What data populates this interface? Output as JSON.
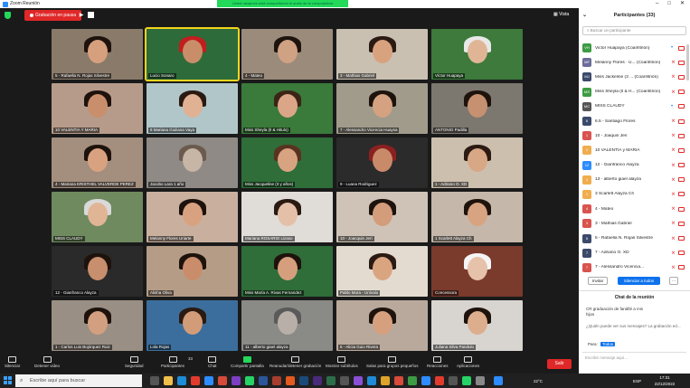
{
  "window": {
    "title": "Zoom Reunión",
    "controls": [
      "–",
      "□",
      "✕"
    ]
  },
  "top_bar": {
    "recording_label": "Grabación en pausa",
    "notice": "Usted rasapnes está compartiendo el audio de la computadora",
    "view_label": "Vista"
  },
  "tiles": [
    {
      "name": "5 - Rafaella N. Rojas Silvestre",
      "bg": "#8a7a6a",
      "skin": "#d6a07e",
      "hair": "#1e120c"
    },
    {
      "name": "Lucio Sonaro",
      "bg": "#2d6b3a",
      "skin": "#c98d6a",
      "hair": "#c21e1e",
      "active": true
    },
    {
      "name": "4 - Mateo",
      "bg": "#9b8b7b",
      "skin": "#cfa283",
      "hair": "#1e140e"
    },
    {
      "name": "3 - Mathias Gabriel",
      "bg": "#c9c0b2",
      "skin": "#d9a27e",
      "hair": "#2a1a12"
    },
    {
      "name": "Víctor Huapaya",
      "bg": "#3d7a3c",
      "skin": "#e0b596",
      "hair": "#e8e8e8"
    },
    {
      "name": "10 VALENTIA Y MARIA",
      "bg": "#b79b8a",
      "skin": "#c98e6b",
      "hair": "#1e120c"
    },
    {
      "name": "8 Mariana Giuliana Vaya",
      "bg": "#b1c6c9",
      "skin": "#e1b193",
      "hair": "#2a1a12"
    },
    {
      "name": "Miss Sheyla (Il & Hitulo)",
      "bg": "#3a7a3b",
      "skin": "#dba687",
      "hair": "#3b2416"
    },
    {
      "name": "7 - Alessandro Vicencia Huaysa",
      "bg": "#a19b8c",
      "skin": "#d4a281",
      "hair": "#1e120c"
    },
    {
      "name": "ANTONIO Padilla",
      "bg": "#7c776f",
      "skin": "#c69170",
      "hair": "#1e120c"
    },
    {
      "name": "4 - Mariana KRISTHEL VALVERDE PEREZ",
      "bg": "#a48f7f",
      "skin": "#d8a281",
      "hair": "#1e120c"
    },
    {
      "name": "Jacobo Lara 1 año",
      "bg": "#8f8a85",
      "skin": "#c7b5a5",
      "hair": "#6b5b4e"
    },
    {
      "name": "Miss Jacqueline (3 y años)",
      "bg": "#2f6d39",
      "skin": "#d8a381",
      "hair": "#5a3320"
    },
    {
      "name": "9 - Luana Rodriguez",
      "bg": "#2b2b2b",
      "skin": "#c98a6a",
      "hair": "#8b2020"
    },
    {
      "name": "1 - Adriano O. XD",
      "bg": "#cdbfae",
      "skin": "#d8a785",
      "hair": "#2a1a12"
    },
    {
      "name": "MISS CLAUDY",
      "bg": "#6f8a5e",
      "skin": "#e0b596",
      "hair": "#d9d9d9"
    },
    {
      "name": "Melanny Flores Uriarte",
      "bg": "#c9b09e",
      "skin": "#d8a281",
      "hair": "#1e120c"
    },
    {
      "name": "Mariana ROSARIO Lizaso",
      "bg": "#e0dcd8",
      "skin": "#e5c0a8",
      "hair": "#2a1a12"
    },
    {
      "name": "10 - Joacquin Jerí",
      "bg": "#cfc3b7",
      "skin": "#d39c7a",
      "hair": "#1e120c"
    },
    {
      "name": "1 Scarlett Alayza Ch",
      "bg": "#c5b8aa",
      "skin": "#d8a381",
      "hair": "#1e120c"
    },
    {
      "name": "12 - Gianfranco Alayza",
      "bg": "#2a2a2a",
      "skin": "#c78f6d",
      "hair": "#1e120c"
    },
    {
      "name": "Alisha Oliva",
      "bg": "#b59c86",
      "skin": "#c98d6b",
      "hair": "#1e120c"
    },
    {
      "name": "Miss María A. Rivas Fernandez",
      "bg": "#2f6d39",
      "skin": "#d59f7d",
      "hair": "#1e120c"
    },
    {
      "name": "Pablo Mora - Unívalo",
      "bg": "#e3dbcf",
      "skin": "#d9a581",
      "hair": "#2a1a12"
    },
    {
      "name": "Concessora",
      "bg": "#7a3a2c",
      "skin": "#e7c2aa",
      "hair": "#f5f5f5"
    },
    {
      "name": "1 - Carlos Luis Bojórquez Ruiz",
      "bg": "#9a8f84",
      "skin": "#d2a080",
      "hair": "#1e120c"
    },
    {
      "name": "Lola Rojas",
      "bg": "#3b6e9c",
      "skin": "#d39c78",
      "hair": "#2a1a12"
    },
    {
      "name": "11 - alberto giael alayza",
      "bg": "#8a8a86",
      "skin": "#b8b0a8",
      "hair": "#5a5a5a"
    },
    {
      "name": "6 - Alicia Guio Rivera",
      "bg": "#b9a99c",
      "skin": "#d6a07e",
      "hair": "#1e120c"
    },
    {
      "name": "Juliana Silva Pandulo",
      "bg": "#d8d4d0",
      "skin": "#dcae8d",
      "hair": "#1e120c"
    }
  ],
  "toolbar": {
    "items": [
      {
        "label": "Silenciar",
        "icon": "microphone-icon"
      },
      {
        "label": "Detener video",
        "icon": "video-icon"
      },
      {
        "label": "Seguridad",
        "icon": "shield-icon"
      },
      {
        "label": "Participantes",
        "count": "33",
        "icon": "participants-icon"
      },
      {
        "label": "Chat",
        "icon": "chat-icon"
      },
      {
        "label": "Compartir pantalla",
        "icon": "share-screen-icon",
        "green": true
      },
      {
        "label": "Reanudar/detener grabación",
        "icon": "record-icon"
      },
      {
        "label": "Mostrar subtítulos",
        "icon": "captions-icon"
      },
      {
        "label": "Salas para grupos pequeños",
        "icon": "breakout-icon"
      },
      {
        "label": "Reacciones",
        "icon": "reactions-icon"
      },
      {
        "label": "Aplicaciones",
        "icon": "apps-icon"
      }
    ],
    "end_label": "Salir"
  },
  "participants_panel": {
    "title": "Participantes (33)",
    "search_placeholder": "Buscar un participante",
    "participants": [
      {
        "initials": "VH",
        "name": "Victor Huapaya (Coanfitrión)",
        "color": "#3c9b43",
        "mic_muted": false
      },
      {
        "initials": "MF",
        "name": "Melanny Flores · U... (Coanfitrión)",
        "color": "#6d6d9b",
        "mic_muted": true
      },
      {
        "initials": "MJ",
        "name": "Miss Jackeline (3 ... (Coanfitrión)",
        "color": "#3b4a6b",
        "mic_muted": true
      },
      {
        "initials": "MS",
        "name": "Miss Sheyla (Il & H... (Coanfitrión)",
        "color": "#3c9b43",
        "mic_muted": true
      },
      {
        "initials": "MC",
        "name": "MISS CLAUDY",
        "color": "#555555",
        "mic_muted": false
      },
      {
        "initials": "6",
        "name": "6.5 - Santiago Flores",
        "color": "#3b4a6b",
        "mic_muted": true
      },
      {
        "initials": "1",
        "name": "10 - Joaquin Jeri",
        "color": "#d9534f",
        "mic_muted": true
      },
      {
        "initials": "1",
        "name": "10 VALENTIA y MARIA",
        "color": "#f0ad4e",
        "mic_muted": true
      },
      {
        "initials": "12",
        "name": "12 - Gianfranco Alayza",
        "color": "#2d8cff",
        "mic_muted": true
      },
      {
        "initials": "1",
        "name": "13 - alberto giael alayza",
        "color": "#f0ad4e",
        "mic_muted": true
      },
      {
        "initials": "1",
        "name": "3 Scarlett Alayza Ch",
        "color": "#f0ad4e",
        "mic_muted": true
      },
      {
        "initials": "4",
        "name": "4 - Mateo",
        "color": "#d9534f",
        "mic_muted": true
      },
      {
        "initials": "3",
        "name": "3 - Mathias Gabriel",
        "color": "#d9534f",
        "mic_muted": true
      },
      {
        "initials": "5",
        "name": "5 - Rafaella N. Rojas Silvestre",
        "color": "#3b4a6b",
        "mic_muted": true
      },
      {
        "initials": "7",
        "name": "7 - Adriano O. XD",
        "color": "#3b4a6b",
        "mic_muted": true
      },
      {
        "initials": "7",
        "name": "7 - Alessandro Vicencia...",
        "color": "#d9534f",
        "mic_muted": true
      }
    ],
    "invite_label": "Invitar",
    "mute_all_label": "Silenciar a todos",
    "more_label": "..."
  },
  "chat": {
    "title": "Chat de la reunión",
    "messages": [
      "CR graduación de fanáfié a mis",
      "hijos",
      "¿Quién puede ver sus mensajes? La grabación ed..."
    ],
    "to_prefix": "Para:",
    "to_value": "Todos",
    "placeholder": "Escribir mensaje aquí..."
  },
  "taskbar": {
    "search_placeholder": "Escribe aquí para buscar",
    "weather": "22°C",
    "lang": "ESP",
    "time": "17:31",
    "date": "22/12/2022"
  }
}
